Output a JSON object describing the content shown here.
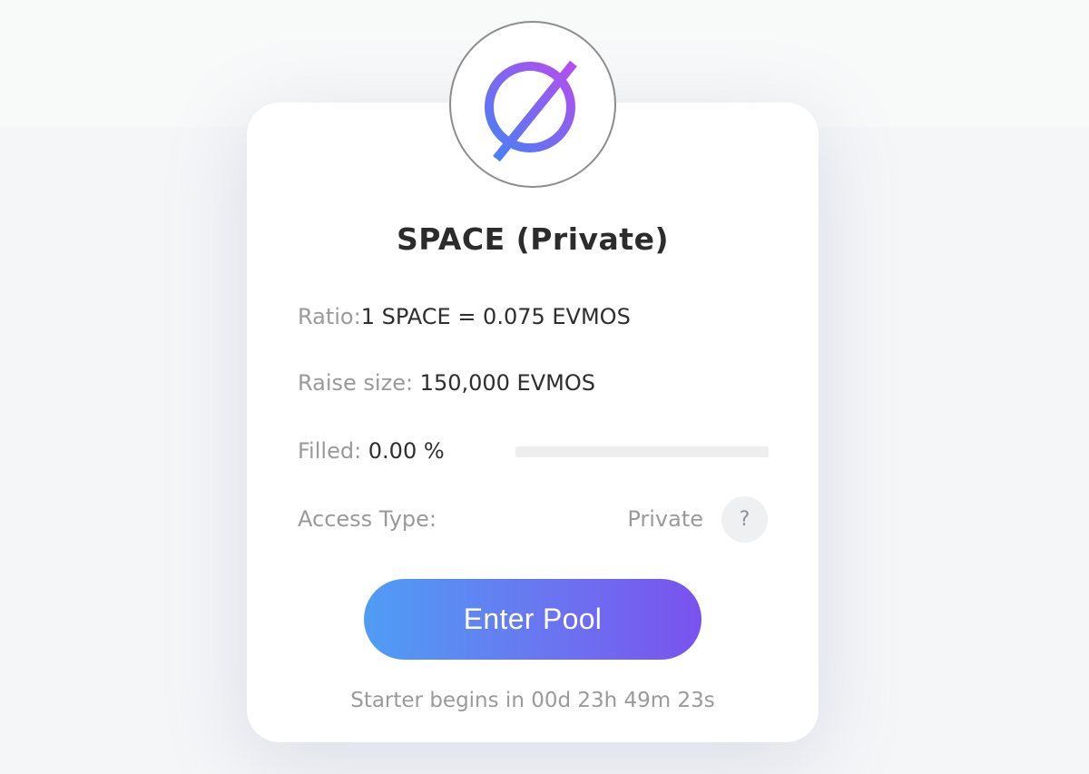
{
  "pool": {
    "title": "SPACE (Private)",
    "logo_icon": "space-token-logo-icon",
    "ratio_label": "Ratio:",
    "ratio_value": "1 SPACE = 0.075 EVMOS",
    "raise_label": "Raise size: ",
    "raise_value": "150,000 EVMOS",
    "filled_label": "Filled: ",
    "filled_value": "0.00 %",
    "filled_fraction": 0,
    "access_label": "Access Type:",
    "access_value": "Private",
    "help_label": "?",
    "enter_label": "Enter Pool",
    "countdown": "Starter begins in 00d 23h 49m 23s"
  },
  "colors": {
    "accent_start": "#4f9df4",
    "accent_end": "#7a52ef",
    "logo_gradient_start": "#4a7ff5",
    "logo_gradient_end": "#b44ef0"
  }
}
